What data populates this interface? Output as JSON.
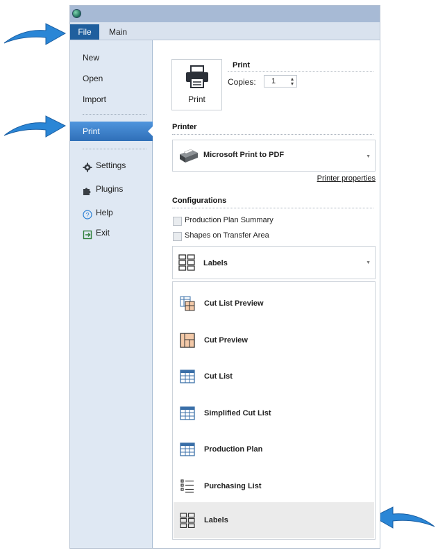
{
  "ribbon": {
    "tabs": [
      "File",
      "Main"
    ]
  },
  "sidebar": {
    "items": [
      {
        "label": "New"
      },
      {
        "label": "Open"
      },
      {
        "label": "Import"
      },
      {
        "label": "Print"
      },
      {
        "label": "Settings"
      },
      {
        "label": "Plugins"
      },
      {
        "label": "Help"
      },
      {
        "label": "Exit"
      }
    ]
  },
  "print": {
    "button_label": "Print",
    "section_title": "Print",
    "copies_label": "Copies:",
    "copies_value": "1"
  },
  "printer": {
    "section_title": "Printer",
    "selected": "Microsoft Print to PDF",
    "properties_link": "Printer properties"
  },
  "configurations": {
    "section_title": "Configurations",
    "options": [
      {
        "label": "Production Plan Summary",
        "checked": false
      },
      {
        "label": "Shapes on Transfer Area",
        "checked": false
      }
    ],
    "selected_report": "Labels",
    "reports": [
      {
        "label": "Cut List Preview",
        "icon": "cut-list-preview-icon"
      },
      {
        "label": "Cut Preview",
        "icon": "cut-preview-icon"
      },
      {
        "label": "Cut List",
        "icon": "table-icon"
      },
      {
        "label": "Simplified Cut List",
        "icon": "table-icon"
      },
      {
        "label": "Production Plan",
        "icon": "table-icon"
      },
      {
        "label": "Purchasing List",
        "icon": "list-icon"
      },
      {
        "label": "Labels",
        "icon": "labels-icon",
        "selected": true
      }
    ]
  },
  "colors": {
    "accent": "#1f5f9e",
    "arrow": "#2a86d6",
    "sidebar_bg": "#dfe8f3"
  }
}
